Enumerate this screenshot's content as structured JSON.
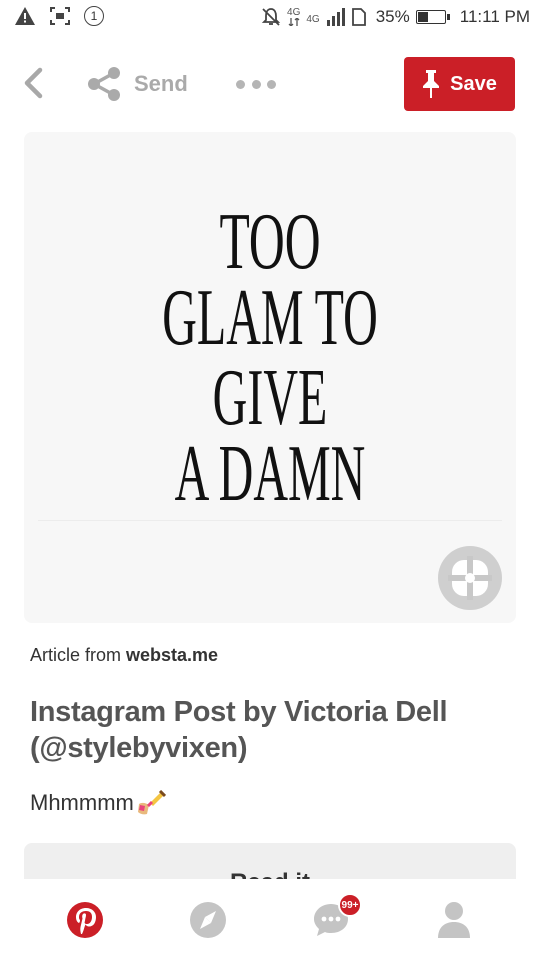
{
  "status_bar": {
    "notification_count": "1",
    "network_top": "4G",
    "network_label": "4G",
    "battery_text": "35%",
    "battery_level": 0.35,
    "time": "11:11 PM"
  },
  "toolbar": {
    "send_label": "Send",
    "save_label": "Save",
    "save_color": "#cb1f27"
  },
  "pin": {
    "image_text": [
      "TOO",
      "GLAM TO GIVE",
      "A DAMN"
    ],
    "source_prefix": "Article from",
    "source_domain": "websta.me",
    "title": "Instagram Post by Victoria Dell (@stylebyvixen)",
    "description": "Mhmmmm",
    "description_emoji": "nail-polish-emoji",
    "read_button_label": "Read it"
  },
  "bottom_nav": {
    "items": [
      "home",
      "explore",
      "messages",
      "profile"
    ],
    "messages_badge": "99+",
    "accent": "#cb1f27",
    "inactive": "#bdbdbd"
  }
}
